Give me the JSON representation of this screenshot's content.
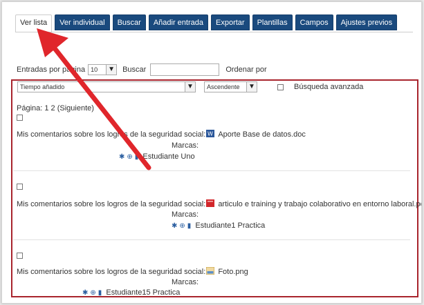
{
  "tabs": [
    {
      "label": "Ver lista",
      "active": true
    },
    {
      "label": "Ver individual",
      "active": false
    },
    {
      "label": "Buscar",
      "active": false
    },
    {
      "label": "Añadir entrada",
      "active": false
    },
    {
      "label": "Exportar",
      "active": false
    },
    {
      "label": "Plantillas",
      "active": false
    },
    {
      "label": "Campos",
      "active": false
    },
    {
      "label": "Ajustes previos",
      "active": false
    }
  ],
  "controls": {
    "entries_label": "Entradas por página",
    "entries_value": "10",
    "search_label": "Buscar",
    "search_value": "",
    "sort_label": "Ordenar por",
    "sort_field": "Tiempo añadido",
    "sort_order": "Ascendente",
    "advanced_label": "Búsqueda avanzada"
  },
  "pagination": "Página: 1 2 (Siguiente)",
  "entries": [
    {
      "field_label": "Mis comentarios sobre los logros de la seguridad social:",
      "file_icon": "word-doc-icon",
      "file_name": "Aporte Base de datos.doc",
      "tags_label": "Marcas:",
      "author": "Estudiante Uno"
    },
    {
      "field_label": "Mis comentarios sobre los logros de la seguridad social:",
      "file_icon": "pdf-icon",
      "file_name": "articulo e training y trabajo colaborativo en entorno laboral.pdf",
      "tags_label": "Marcas:",
      "author": "Estudiante1 Practica"
    },
    {
      "field_label": "Mis comentarios sobre los logros de la seguridad social:",
      "file_icon": "image-icon",
      "file_name": "Foto.png",
      "tags_label": "Marcas:",
      "author": "Estudiante15 Practica"
    }
  ],
  "colors": {
    "tab_bg": "#1a4a7e",
    "highlight_border": "#a8232c",
    "arrow": "#e0262b"
  }
}
